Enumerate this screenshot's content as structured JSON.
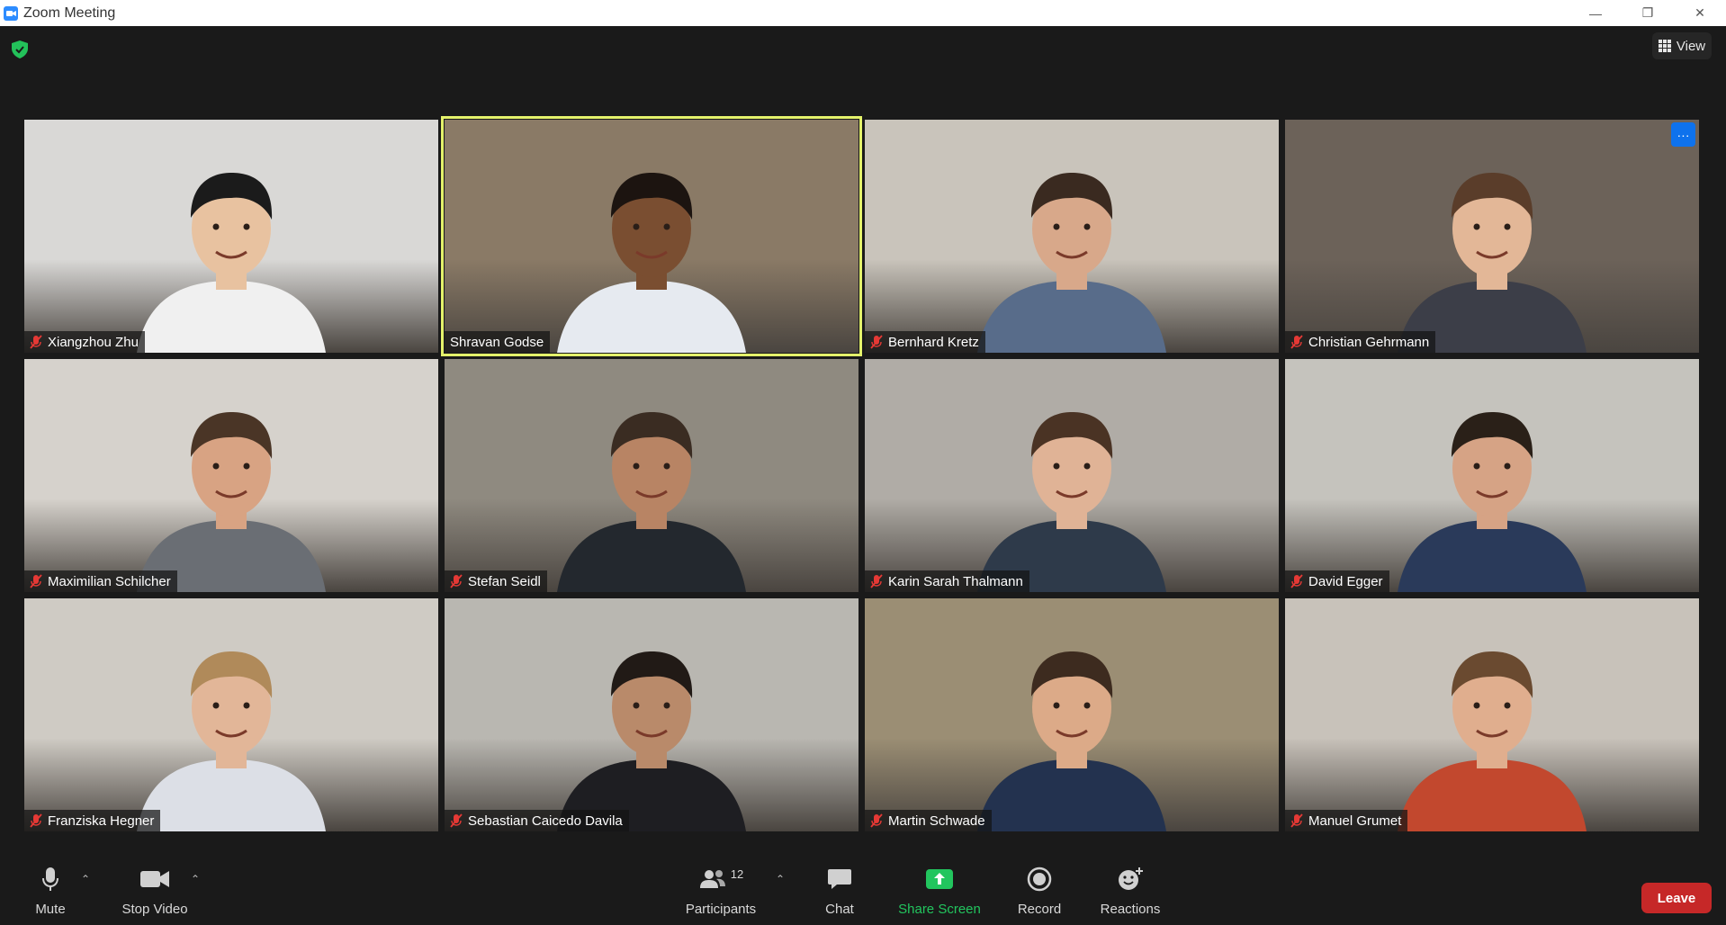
{
  "window": {
    "title": "Zoom Meeting",
    "minimize": "—",
    "restore": "❐",
    "close": "✕"
  },
  "header": {
    "view_label": "View"
  },
  "participants": [
    {
      "name": "Xiangzhou Zhu",
      "bg": "#d9d8d6",
      "skin": "#e8c2a0",
      "hair": "#1b1b1b",
      "shirt": "#f0f0f0"
    },
    {
      "name": "Shravan Godse",
      "bg": "#8a7a66",
      "skin": "#7a4e31",
      "hair": "#1c1410",
      "shirt": "#e6eaf0",
      "active": true
    },
    {
      "name": "Bernhard Kretz",
      "bg": "#c9c4bb",
      "skin": "#d8a88a",
      "hair": "#3a2a20",
      "shirt": "#586c8a"
    },
    {
      "name": "Christian Gehrmann",
      "bg": "#6c6259",
      "skin": "#e3b797",
      "hair": "#5a3d2a",
      "shirt": "#3c3e48",
      "more": true
    },
    {
      "name": "Maximilian Schilcher",
      "bg": "#d6d2cc",
      "skin": "#d8a383",
      "hair": "#4a3526",
      "shirt": "#6a6e74"
    },
    {
      "name": "Stefan Seidl",
      "bg": "#8f8a80",
      "skin": "#b88464",
      "hair": "#3a2c22",
      "shirt": "#23282e"
    },
    {
      "name": "Karin Sarah Thalmann",
      "bg": "#b0aca6",
      "skin": "#e0b396",
      "hair": "#4a3324",
      "shirt": "#2e3a4a"
    },
    {
      "name": "David Egger",
      "bg": "#c5c3bd",
      "skin": "#d6a385",
      "hair": "#2a2018",
      "shirt": "#2a3a5a"
    },
    {
      "name": "Franziska Hegner",
      "bg": "#cfcbc4",
      "skin": "#e2b698",
      "hair": "#b08a5a",
      "shirt": "#dcdfe6"
    },
    {
      "name": "Sebastian Caicedo Davila",
      "bg": "#b9b7b1",
      "skin": "#b98a6a",
      "hair": "#211a16",
      "shirt": "#1e1e22"
    },
    {
      "name": "Martin Schwade",
      "bg": "#9b8e74",
      "skin": "#dcaa88",
      "hair": "#3d2b1f",
      "shirt": "#23324f"
    },
    {
      "name": "Manuel Grumet",
      "bg": "#c8c2ba",
      "skin": "#e0ae8e",
      "hair": "#6a4a30",
      "shirt": "#c2482e"
    }
  ],
  "toolbar": {
    "mute": "Mute",
    "stop_video": "Stop Video",
    "participants": "Participants",
    "participants_count": "12",
    "chat": "Chat",
    "share_screen": "Share Screen",
    "record": "Record",
    "reactions": "Reactions",
    "leave": "Leave"
  },
  "colors": {
    "active_speaker": "#e4f26b",
    "share_green": "#22c55e",
    "leave_red": "#c62828",
    "more_blue": "#0e72ed"
  }
}
